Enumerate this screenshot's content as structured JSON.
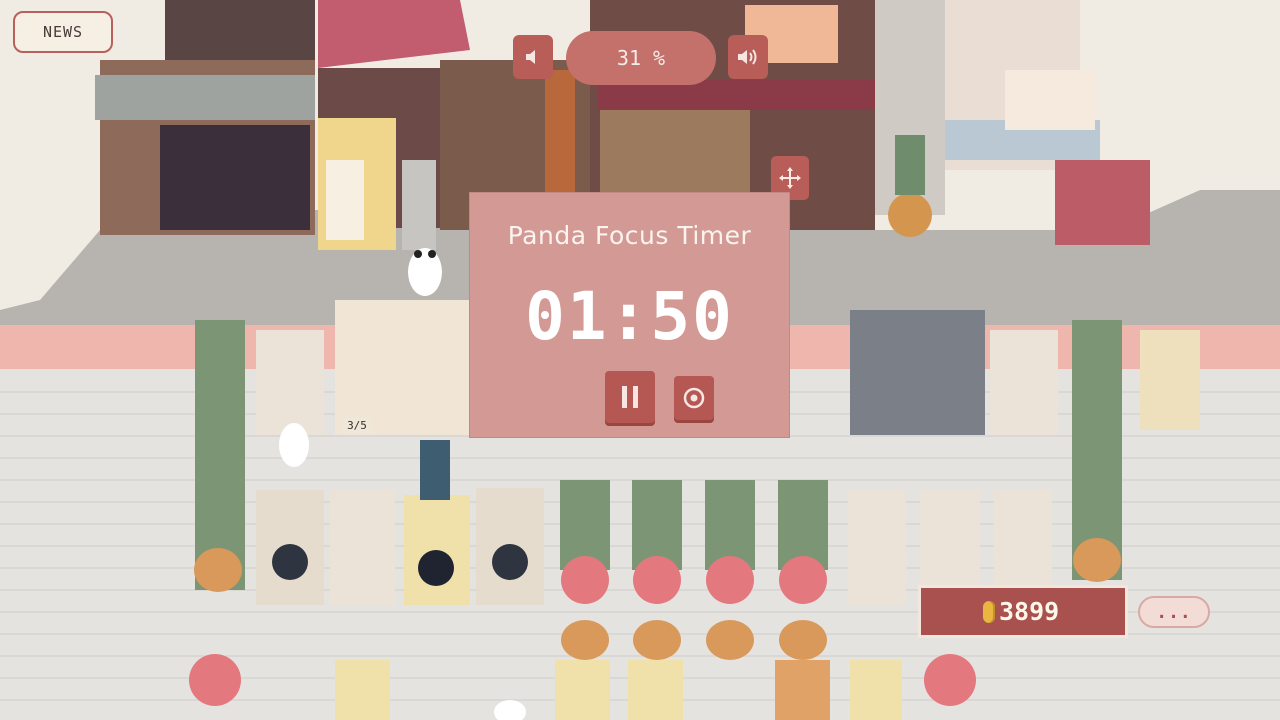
{
  "scene": {
    "type": "pixel-art laundromat street with pandas, plants and washing machines"
  },
  "news_button": {
    "label": "NEWS"
  },
  "volume": {
    "value": "31 %",
    "decrease_icon": "speaker-low-icon",
    "increase_icon": "speaker-high-icon"
  },
  "move_icon": "move-arrows-icon",
  "timer": {
    "title": "Panda Focus Timer",
    "time": "01:50",
    "pause_icon": "pause-icon",
    "reset_icon": "target-reset-icon"
  },
  "stock_label": "3/5",
  "coins": {
    "value": "3899",
    "icon": "coin-icon"
  },
  "more_button": {
    "label": "..."
  },
  "colors": {
    "accent": "#b85d58",
    "panel": "#d39a95",
    "floor": "#e6e4e1",
    "street": "#b9b6b1"
  }
}
